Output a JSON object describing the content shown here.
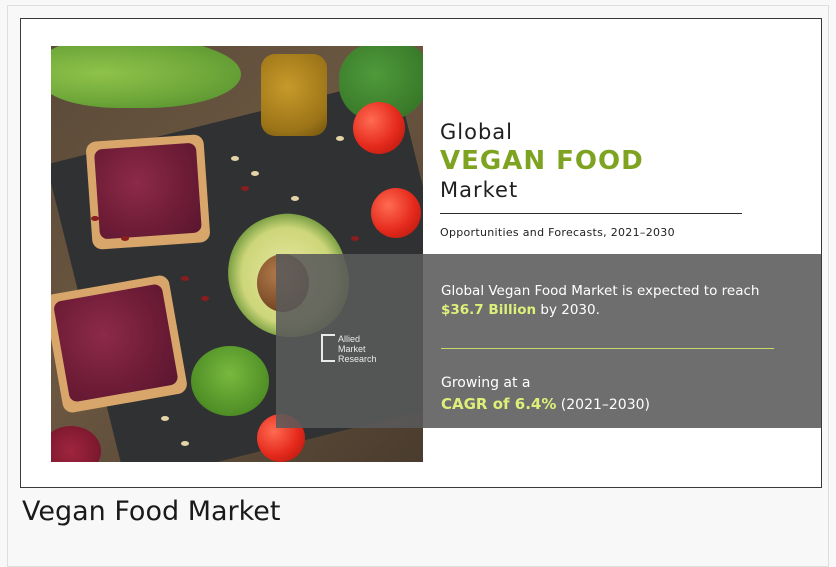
{
  "infographic": {
    "title_line1": "Global",
    "title_line2": "VEGAN FOOD",
    "title_line3": "Market",
    "subtitle": "Opportunities and Forecasts, 2021–2030",
    "band": {
      "line1_prefix": "Global Vegan Food Market is expected to reach ",
      "market_value": "$36.7 Billion",
      "line1_suffix": " by 2030.",
      "growing_label": "Growing at a",
      "cagr_label": "CAGR of 6.4%",
      "cagr_period": " (2021–2030)"
    },
    "logo": {
      "line1": "Allied",
      "line2": "Market",
      "line3": "Research"
    },
    "colors": {
      "accent_green": "#7ea321",
      "highlight_yellow": "#dff07a",
      "band_gray": "#5a5a5a"
    }
  },
  "caption": "Vegan Food Market"
}
